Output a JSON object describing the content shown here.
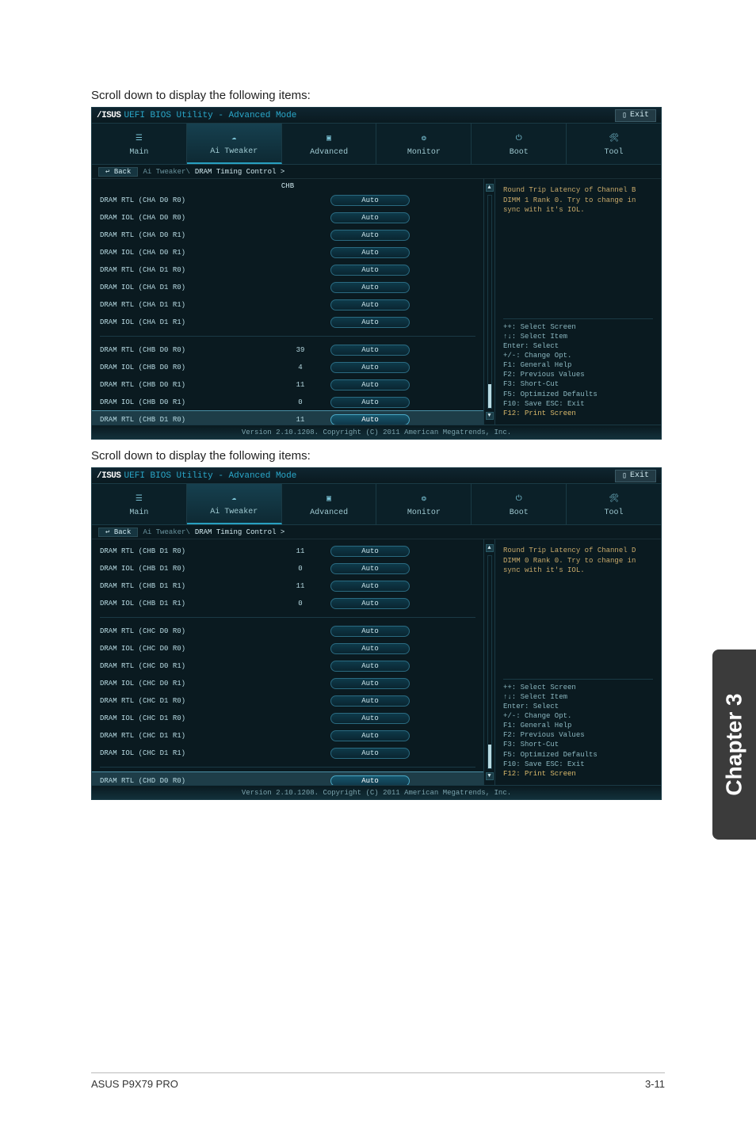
{
  "caption1": "Scroll down to display the following items:",
  "caption2": "Scroll down to display the following items:",
  "logo": "/ISUS",
  "bios_title": "UEFI BIOS Utility - Advanced Mode",
  "exit_label": "Exit",
  "tabs": [
    "Main",
    "Ai Tweaker",
    "Advanced",
    "Monitor",
    "Boot",
    "Tool"
  ],
  "back_label": "Back",
  "breadcrumb": {
    "root": "Ai Tweaker\\",
    "last": "DRAM Timing Control >"
  },
  "chb_header": "CHB",
  "panel1": {
    "help": "Round Trip Latency of Channel B DIMM 1 Rank 0. Try to change in sync with it's IOL.",
    "rows_a": [
      {
        "label": "DRAM RTL (CHA D0 R0)",
        "num": "",
        "val": "Auto"
      },
      {
        "label": "DRAM IOL (CHA D0 R0)",
        "num": "",
        "val": "Auto"
      },
      {
        "label": "DRAM RTL (CHA D0 R1)",
        "num": "",
        "val": "Auto"
      },
      {
        "label": "DRAM IOL (CHA D0 R1)",
        "num": "",
        "val": "Auto"
      },
      {
        "label": "DRAM RTL (CHA D1 R0)",
        "num": "",
        "val": "Auto"
      },
      {
        "label": "DRAM IOL (CHA D1 R0)",
        "num": "",
        "val": "Auto"
      },
      {
        "label": "DRAM RTL (CHA D1 R1)",
        "num": "",
        "val": "Auto"
      },
      {
        "label": "DRAM IOL (CHA D1 R1)",
        "num": "",
        "val": "Auto"
      }
    ],
    "rows_b": [
      {
        "label": "DRAM RTL (CHB D0 R0)",
        "num": "39",
        "val": "Auto"
      },
      {
        "label": "DRAM IOL (CHB D0 R0)",
        "num": "4",
        "val": "Auto"
      },
      {
        "label": "DRAM RTL (CHB D0 R1)",
        "num": "11",
        "val": "Auto"
      },
      {
        "label": "DRAM IOL (CHB D0 R1)",
        "num": "0",
        "val": "Auto"
      },
      {
        "label": "DRAM RTL (CHB D1 R0)",
        "num": "11",
        "val": "Auto",
        "sel": true
      }
    ]
  },
  "panel2": {
    "help": "Round Trip Latency of Channel D DIMM 0 Rank 0. Try to change in sync with it's IOL.",
    "rows_top": [
      {
        "label": "DRAM RTL (CHB D1 R0)",
        "num": "11",
        "val": "Auto"
      },
      {
        "label": "DRAM IOL (CHB D1 R0)",
        "num": "0",
        "val": "Auto"
      },
      {
        "label": "DRAM RTL (CHB D1 R1)",
        "num": "11",
        "val": "Auto"
      },
      {
        "label": "DRAM IOL (CHB D1 R1)",
        "num": "0",
        "val": "Auto"
      }
    ],
    "rows_c": [
      {
        "label": "DRAM RTL (CHC D0 R0)",
        "num": "",
        "val": "Auto"
      },
      {
        "label": "DRAM IOL (CHC D0 R0)",
        "num": "",
        "val": "Auto"
      },
      {
        "label": "DRAM RTL (CHC D0 R1)",
        "num": "",
        "val": "Auto"
      },
      {
        "label": "DRAM IOL (CHC D0 R1)",
        "num": "",
        "val": "Auto"
      },
      {
        "label": "DRAM RTL (CHC D1 R0)",
        "num": "",
        "val": "Auto"
      },
      {
        "label": "DRAM IOL (CHC D1 R0)",
        "num": "",
        "val": "Auto"
      },
      {
        "label": "DRAM RTL (CHC D1 R1)",
        "num": "",
        "val": "Auto"
      },
      {
        "label": "DRAM IOL (CHC D1 R1)",
        "num": "",
        "val": "Auto"
      }
    ],
    "rows_sel": [
      {
        "label": "DRAM RTL (CHD D0 R0)",
        "num": "",
        "val": "Auto",
        "sel": true
      }
    ]
  },
  "keyhelp": [
    "++: Select Screen",
    "↑↓: Select Item",
    "Enter: Select",
    "+/-: Change Opt.",
    "F1: General Help",
    "F2: Previous Values",
    "F3: Short-Cut",
    "F5: Optimized Defaults",
    "F10: Save  ESC: Exit"
  ],
  "keyhelp_print": "F12: Print Screen",
  "bios_footer": "Version 2.10.1208. Copyright (C) 2011 American Megatrends, Inc.",
  "side_tab": "Chapter 3",
  "footer": {
    "left": "ASUS P9X79 PRO",
    "right": "3-11"
  }
}
